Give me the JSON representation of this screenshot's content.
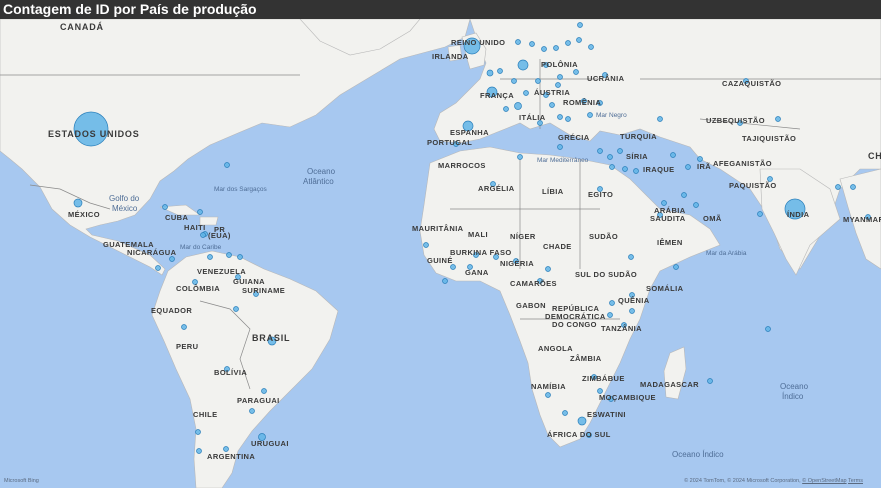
{
  "title": "Contagem de ID por País de produção",
  "colors": {
    "ocean": "#a7c8f0",
    "land": "#f2f2ef",
    "border": "#8a8a8a",
    "bubble_fill": "#5fb4e6",
    "bubble_stroke": "#2a7fba",
    "header_bg": "#333333"
  },
  "country_labels": [
    {
      "id": "canada",
      "text": "CANADÁ",
      "size": "big"
    },
    {
      "id": "estados-unidos",
      "text": "ESTADOS UNIDOS",
      "size": "big"
    },
    {
      "id": "mexico",
      "text": "MÉXICO",
      "size": "country"
    },
    {
      "id": "cuba",
      "text": "CUBA",
      "size": "country"
    },
    {
      "id": "haiti",
      "text": "HAITI",
      "size": "country"
    },
    {
      "id": "pr",
      "text": "PR",
      "size": "country"
    },
    {
      "id": "pr-eua",
      "text": "(EUA)",
      "size": "country"
    },
    {
      "id": "guatemala",
      "text": "GUATEMALA",
      "size": "country"
    },
    {
      "id": "nicaragua",
      "text": "NICARÁGUA",
      "size": "country"
    },
    {
      "id": "venezuela",
      "text": "VENEZUELA",
      "size": "country"
    },
    {
      "id": "guiana",
      "text": "GUIANA",
      "size": "country"
    },
    {
      "id": "suriname",
      "text": "SURINAME",
      "size": "country"
    },
    {
      "id": "colombia",
      "text": "COLÔMBIA",
      "size": "country"
    },
    {
      "id": "equador",
      "text": "EQUADOR",
      "size": "country"
    },
    {
      "id": "peru",
      "text": "PERU",
      "size": "country"
    },
    {
      "id": "brasil",
      "text": "BRASIL",
      "size": "big"
    },
    {
      "id": "bolivia",
      "text": "BOLÍVIA",
      "size": "country"
    },
    {
      "id": "paraguai",
      "text": "PARAGUAI",
      "size": "country"
    },
    {
      "id": "chile",
      "text": "CHILE",
      "size": "country"
    },
    {
      "id": "uruguai",
      "text": "URUGUAI",
      "size": "country"
    },
    {
      "id": "argentina",
      "text": "ARGENTINA",
      "size": "country"
    },
    {
      "id": "irlanda",
      "text": "IRLANDA",
      "size": "country"
    },
    {
      "id": "reino-unido",
      "text": "REINO UNIDO",
      "size": "country"
    },
    {
      "id": "polonia",
      "text": "POLÔNIA",
      "size": "country"
    },
    {
      "id": "ucrania",
      "text": "UCRÂNIA",
      "size": "country"
    },
    {
      "id": "franca",
      "text": "FRANÇA",
      "size": "country"
    },
    {
      "id": "austria",
      "text": "ÁUSTRIA",
      "size": "country"
    },
    {
      "id": "romenia",
      "text": "ROMÊNIA",
      "size": "country"
    },
    {
      "id": "italia",
      "text": "ITÁLIA",
      "size": "country"
    },
    {
      "id": "espanha",
      "text": "ESPANHA",
      "size": "country"
    },
    {
      "id": "portugal",
      "text": "PORTUGAL",
      "size": "country"
    },
    {
      "id": "grecia",
      "text": "GRÉCIA",
      "size": "country"
    },
    {
      "id": "turquia",
      "text": "TURQUIA",
      "size": "country"
    },
    {
      "id": "cazaquistao",
      "text": "CAZAQUISTÃO",
      "size": "country"
    },
    {
      "id": "uzbequistao",
      "text": "UZBEQUISTÃO",
      "size": "country"
    },
    {
      "id": "tajiquistao",
      "text": "TAJIQUISTÃO",
      "size": "country"
    },
    {
      "id": "marrocos",
      "text": "MARROCOS",
      "size": "country"
    },
    {
      "id": "argelia",
      "text": "ARGÉLIA",
      "size": "country"
    },
    {
      "id": "libia",
      "text": "LÍBIA",
      "size": "country"
    },
    {
      "id": "egito",
      "text": "EGITO",
      "size": "country"
    },
    {
      "id": "siria",
      "text": "SÍRIA",
      "size": "country"
    },
    {
      "id": "iraque",
      "text": "IRAQUE",
      "size": "country"
    },
    {
      "id": "ira",
      "text": "IRÃ",
      "size": "country"
    },
    {
      "id": "afeganistao",
      "text": "AFEGANISTÃO",
      "size": "country"
    },
    {
      "id": "paquistao",
      "text": "PAQUISTÃO",
      "size": "country"
    },
    {
      "id": "arabia-saudita-1",
      "text": "ARÁBIA",
      "size": "country"
    },
    {
      "id": "arabia-saudita-2",
      "text": "SAUDITA",
      "size": "country"
    },
    {
      "id": "oma",
      "text": "OMÃ",
      "size": "country"
    },
    {
      "id": "iemen",
      "text": "IÊMEN",
      "size": "country"
    },
    {
      "id": "india",
      "text": "ÍNDIA",
      "size": "country"
    },
    {
      "id": "myanmar",
      "text": "MYANMAR",
      "size": "country"
    },
    {
      "id": "china-partial",
      "text": "CH",
      "size": "big"
    },
    {
      "id": "mauritania",
      "text": "MAURITÂNIA",
      "size": "country"
    },
    {
      "id": "mali",
      "text": "MALI",
      "size": "country"
    },
    {
      "id": "niger",
      "text": "NÍGER",
      "size": "country"
    },
    {
      "id": "chade",
      "text": "CHADE",
      "size": "country"
    },
    {
      "id": "sudao",
      "text": "SUDÃO",
      "size": "country"
    },
    {
      "id": "burkina-faso",
      "text": "BURKINA FASO",
      "size": "country"
    },
    {
      "id": "guine",
      "text": "GUINÉ",
      "size": "country"
    },
    {
      "id": "gana",
      "text": "GANA",
      "size": "country"
    },
    {
      "id": "nigeria",
      "text": "NIGÉRIA",
      "size": "country"
    },
    {
      "id": "camaroes",
      "text": "CAMARÕES",
      "size": "country"
    },
    {
      "id": "sul-do-sudao",
      "text": "SUL DO SUDÃO",
      "size": "country"
    },
    {
      "id": "somalia",
      "text": "SOMÁLIA",
      "size": "country"
    },
    {
      "id": "quenia",
      "text": "QUÊNIA",
      "size": "country"
    },
    {
      "id": "gabon",
      "text": "GABON",
      "size": "country"
    },
    {
      "id": "rdc-1",
      "text": "REPÚBLICA",
      "size": "country"
    },
    {
      "id": "rdc-2",
      "text": "DEMOCRÁTICA",
      "size": "country"
    },
    {
      "id": "rdc-3",
      "text": "DO CONGO",
      "size": "country"
    },
    {
      "id": "tanzania",
      "text": "TANZÂNIA",
      "size": "country"
    },
    {
      "id": "angola",
      "text": "ANGOLA",
      "size": "country"
    },
    {
      "id": "zambia",
      "text": "ZÂMBIA",
      "size": "country"
    },
    {
      "id": "zimbabue",
      "text": "ZIMBÁBUE",
      "size": "country"
    },
    {
      "id": "namibia",
      "text": "NAMÍBIA",
      "size": "country"
    },
    {
      "id": "mocambique",
      "text": "MOÇAMBIQUE",
      "size": "country"
    },
    {
      "id": "madagascar",
      "text": "MADAGASCAR",
      "size": "country"
    },
    {
      "id": "eswatini",
      "text": "ESWATINI",
      "size": "country"
    },
    {
      "id": "africa-do-sul",
      "text": "ÁFRICA DO SUL",
      "size": "country"
    }
  ],
  "water_labels": [
    {
      "id": "oceano-atlantico-1",
      "text": "Oceano",
      "size": "ocean"
    },
    {
      "id": "oceano-atlantico-2",
      "text": "Atlântico",
      "size": "ocean"
    },
    {
      "id": "mar-dos-sargacos",
      "text": "Mar dos Sargaços",
      "size": "ocean-s"
    },
    {
      "id": "golfo-do-mexico-1",
      "text": "Golfo do",
      "size": "ocean"
    },
    {
      "id": "golfo-do-mexico-2",
      "text": "México",
      "size": "ocean"
    },
    {
      "id": "mar-do-caribe",
      "text": "Mar do Caribe",
      "size": "ocean-s"
    },
    {
      "id": "mar-negro",
      "text": "Mar Negro",
      "size": "ocean-s"
    },
    {
      "id": "mar-mediterraneo",
      "text": "Mar Mediterrâneo",
      "size": "ocean-s"
    },
    {
      "id": "mar-da-arabia",
      "text": "Mar da Arábia",
      "size": "ocean-s"
    },
    {
      "id": "oceano-indico-1",
      "text": "Oceano",
      "size": "ocean"
    },
    {
      "id": "oceano-indico-2",
      "text": "Índico",
      "size": "ocean"
    },
    {
      "id": "oceano-indico-3",
      "text": "Oceano Índico",
      "size": "ocean"
    }
  ],
  "bubbles": [
    {
      "id": "usa",
      "r": 17
    },
    {
      "id": "uk",
      "r": 8
    },
    {
      "id": "india",
      "r": 10
    },
    {
      "id": "spain",
      "r": 5
    },
    {
      "id": "france",
      "r": 5
    },
    {
      "id": "germany",
      "r": 5
    },
    {
      "id": "brazil",
      "r": 4
    },
    {
      "id": "mexico",
      "r": 4
    },
    {
      "id": "south-africa",
      "r": 4
    },
    {
      "id": "italy",
      "r": 3.5
    },
    {
      "id": "argentina",
      "r": 3.5
    },
    {
      "id": "australia-east",
      "r": 3
    },
    {
      "id": "misc",
      "r": 2.5
    }
  ],
  "footer": {
    "logo": "Microsoft Bing",
    "credit": "© 2024 TomTom, © 2024 Microsoft Corporation,",
    "osm": "© OpenStreetMap",
    "terms": "Terms"
  }
}
